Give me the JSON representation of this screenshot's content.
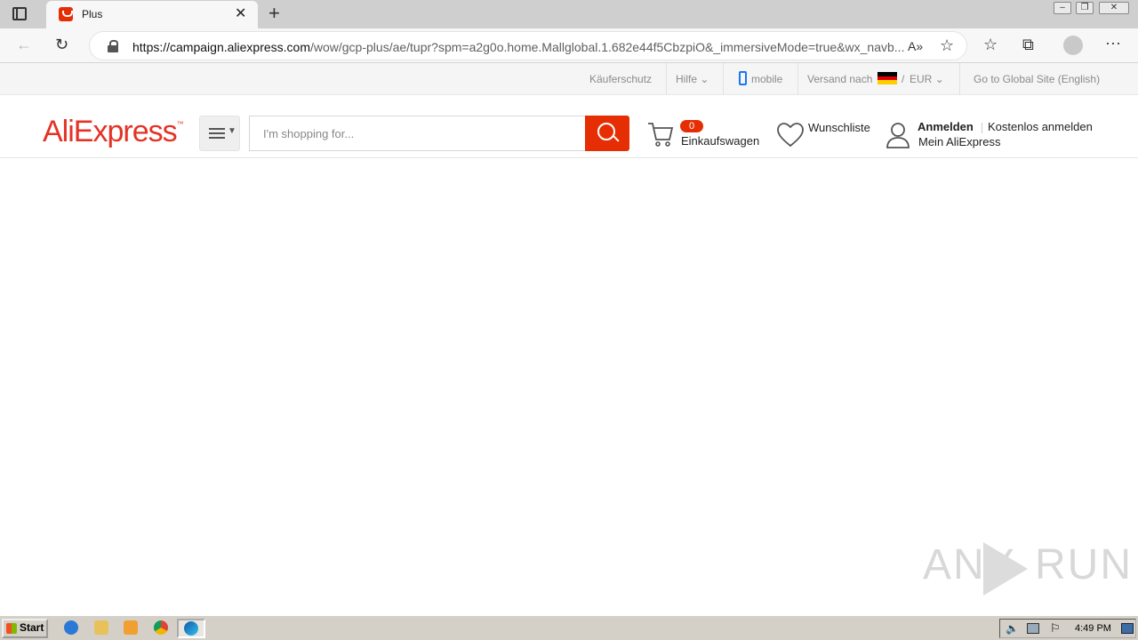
{
  "browser": {
    "tab_title": "Plus",
    "url_host": "https://campaign.aliexpress.com",
    "url_path": "/wow/gcp-plus/ae/tupr?spm=a2g0o.home.Mallglobal.1.682e44f5CbzpiO&_immersiveMode=true&wx_navb..."
  },
  "topbar": {
    "buyer_protection": "Käuferschutz",
    "help": "Hilfe",
    "mobile": "mobile",
    "ship_to": "Versand nach",
    "currency_sep": "/",
    "currency": "EUR",
    "global_site": "Go to Global Site (English)"
  },
  "header": {
    "logo": "AliExpress",
    "search_placeholder": "I'm shopping for...",
    "cart_count": "0",
    "cart_label": "Einkaufswagen",
    "wishlist_label": "Wunschliste",
    "signin_label": "Anmelden",
    "register_label": "Kostenlos anmelden",
    "my_account_label": "Mein AliExpress"
  },
  "watermark": {
    "left": "ANY",
    "right": "RUN"
  },
  "taskbar": {
    "start_label": "Start",
    "clock": "4:49 PM"
  },
  "colors": {
    "brand": "#e62e04",
    "logo": "#e43225"
  }
}
